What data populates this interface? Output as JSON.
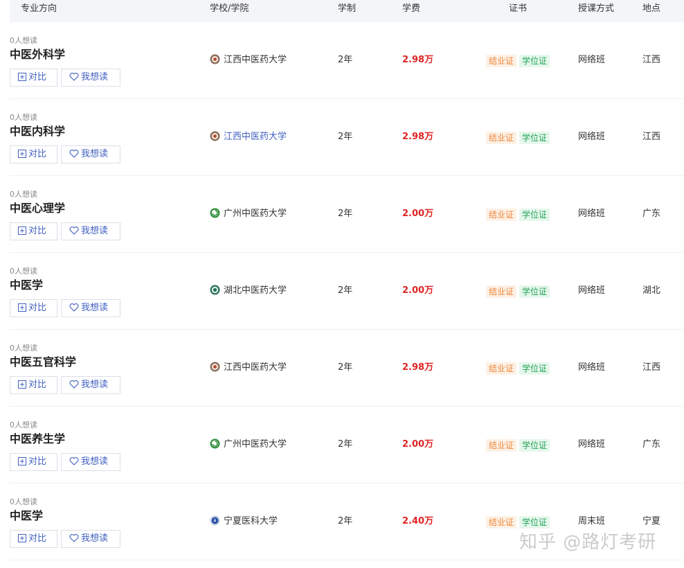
{
  "header": {
    "major": "专业方向",
    "school": "学校/学院",
    "duration": "学制",
    "fee": "学费",
    "certificate": "证书",
    "mode": "授课方式",
    "location": "地点"
  },
  "buttons": {
    "compare": "对比",
    "want": "我想读"
  },
  "tags": {
    "cert": "结业证",
    "degree": "学位证"
  },
  "rows": [
    {
      "count": "0人想读",
      "major": "中医外科学",
      "school": "江西中医药大学",
      "school_logo": "jiangxi-logo",
      "duration": "2年",
      "fee": "2.98万",
      "mode": "网络班",
      "location": "江西"
    },
    {
      "count": "0人想读",
      "major": "中医内科学",
      "school": "江西中医药大学",
      "school_logo": "jiangxi-logo",
      "duration": "2年",
      "fee": "2.98万",
      "mode": "网络班",
      "location": "江西"
    },
    {
      "count": "0人想读",
      "major": "中医心理学",
      "school": "广州中医药大学",
      "school_logo": "guangzhou-logo",
      "duration": "2年",
      "fee": "2.00万",
      "mode": "网络班",
      "location": "广东"
    },
    {
      "count": "0人想读",
      "major": "中医学",
      "school": "湖北中医药大学",
      "school_logo": "hubei-logo",
      "duration": "2年",
      "fee": "2.00万",
      "mode": "网络班",
      "location": "湖北"
    },
    {
      "count": "0人想读",
      "major": "中医五官科学",
      "school": "江西中医药大学",
      "school_logo": "jiangxi-logo",
      "duration": "2年",
      "fee": "2.98万",
      "mode": "网络班",
      "location": "江西"
    },
    {
      "count": "0人想读",
      "major": "中医养生学",
      "school": "广州中医药大学",
      "school_logo": "guangzhou-logo",
      "duration": "2年",
      "fee": "2.00万",
      "mode": "网络班",
      "location": "广东"
    },
    {
      "count": "0人想读",
      "major": "中医学",
      "school": "宁夏医科大学",
      "school_logo": "ningxia-logo",
      "duration": "2年",
      "fee": "2.40万",
      "mode": "周末班",
      "location": "宁夏"
    }
  ],
  "colors": {
    "fee": "#e02424",
    "link": "#3f5fbf",
    "cert_tag": "#f0873a",
    "degree_tag": "#23a55a"
  },
  "watermark": "知乎 @路灯考研"
}
